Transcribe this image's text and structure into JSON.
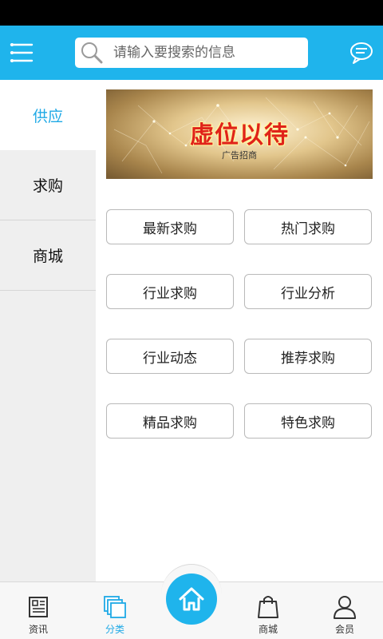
{
  "header": {
    "search_placeholder": "请输入要搜索的信息",
    "icons": {
      "menu": "menu-icon",
      "search": "search-icon",
      "message": "chat-bubble-icon"
    },
    "accent_color": "#1fb4ec"
  },
  "sidebar": {
    "items": [
      {
        "label": "供应",
        "active": true
      },
      {
        "label": "求购",
        "active": false
      },
      {
        "label": "商城",
        "active": false
      }
    ]
  },
  "banner": {
    "title": "虚位以待",
    "subtitle": "广告招商"
  },
  "buttons": [
    {
      "label": "最新求购"
    },
    {
      "label": "热门求购"
    },
    {
      "label": "行业求购"
    },
    {
      "label": "行业分析"
    },
    {
      "label": "行业动态"
    },
    {
      "label": "推荐求购"
    },
    {
      "label": "精品求购"
    },
    {
      "label": "特色求购"
    }
  ],
  "bottom_nav": {
    "items": [
      {
        "label": "资讯",
        "icon": "newspaper-icon",
        "active": false
      },
      {
        "label": "分类",
        "icon": "layers-icon",
        "active": true
      },
      {
        "label": "",
        "icon": "home-icon",
        "active": false
      },
      {
        "label": "商城",
        "icon": "shopping-bag-icon",
        "active": false
      },
      {
        "label": "会员",
        "icon": "user-icon",
        "active": false
      }
    ],
    "active_color": "#1fa9e6"
  }
}
